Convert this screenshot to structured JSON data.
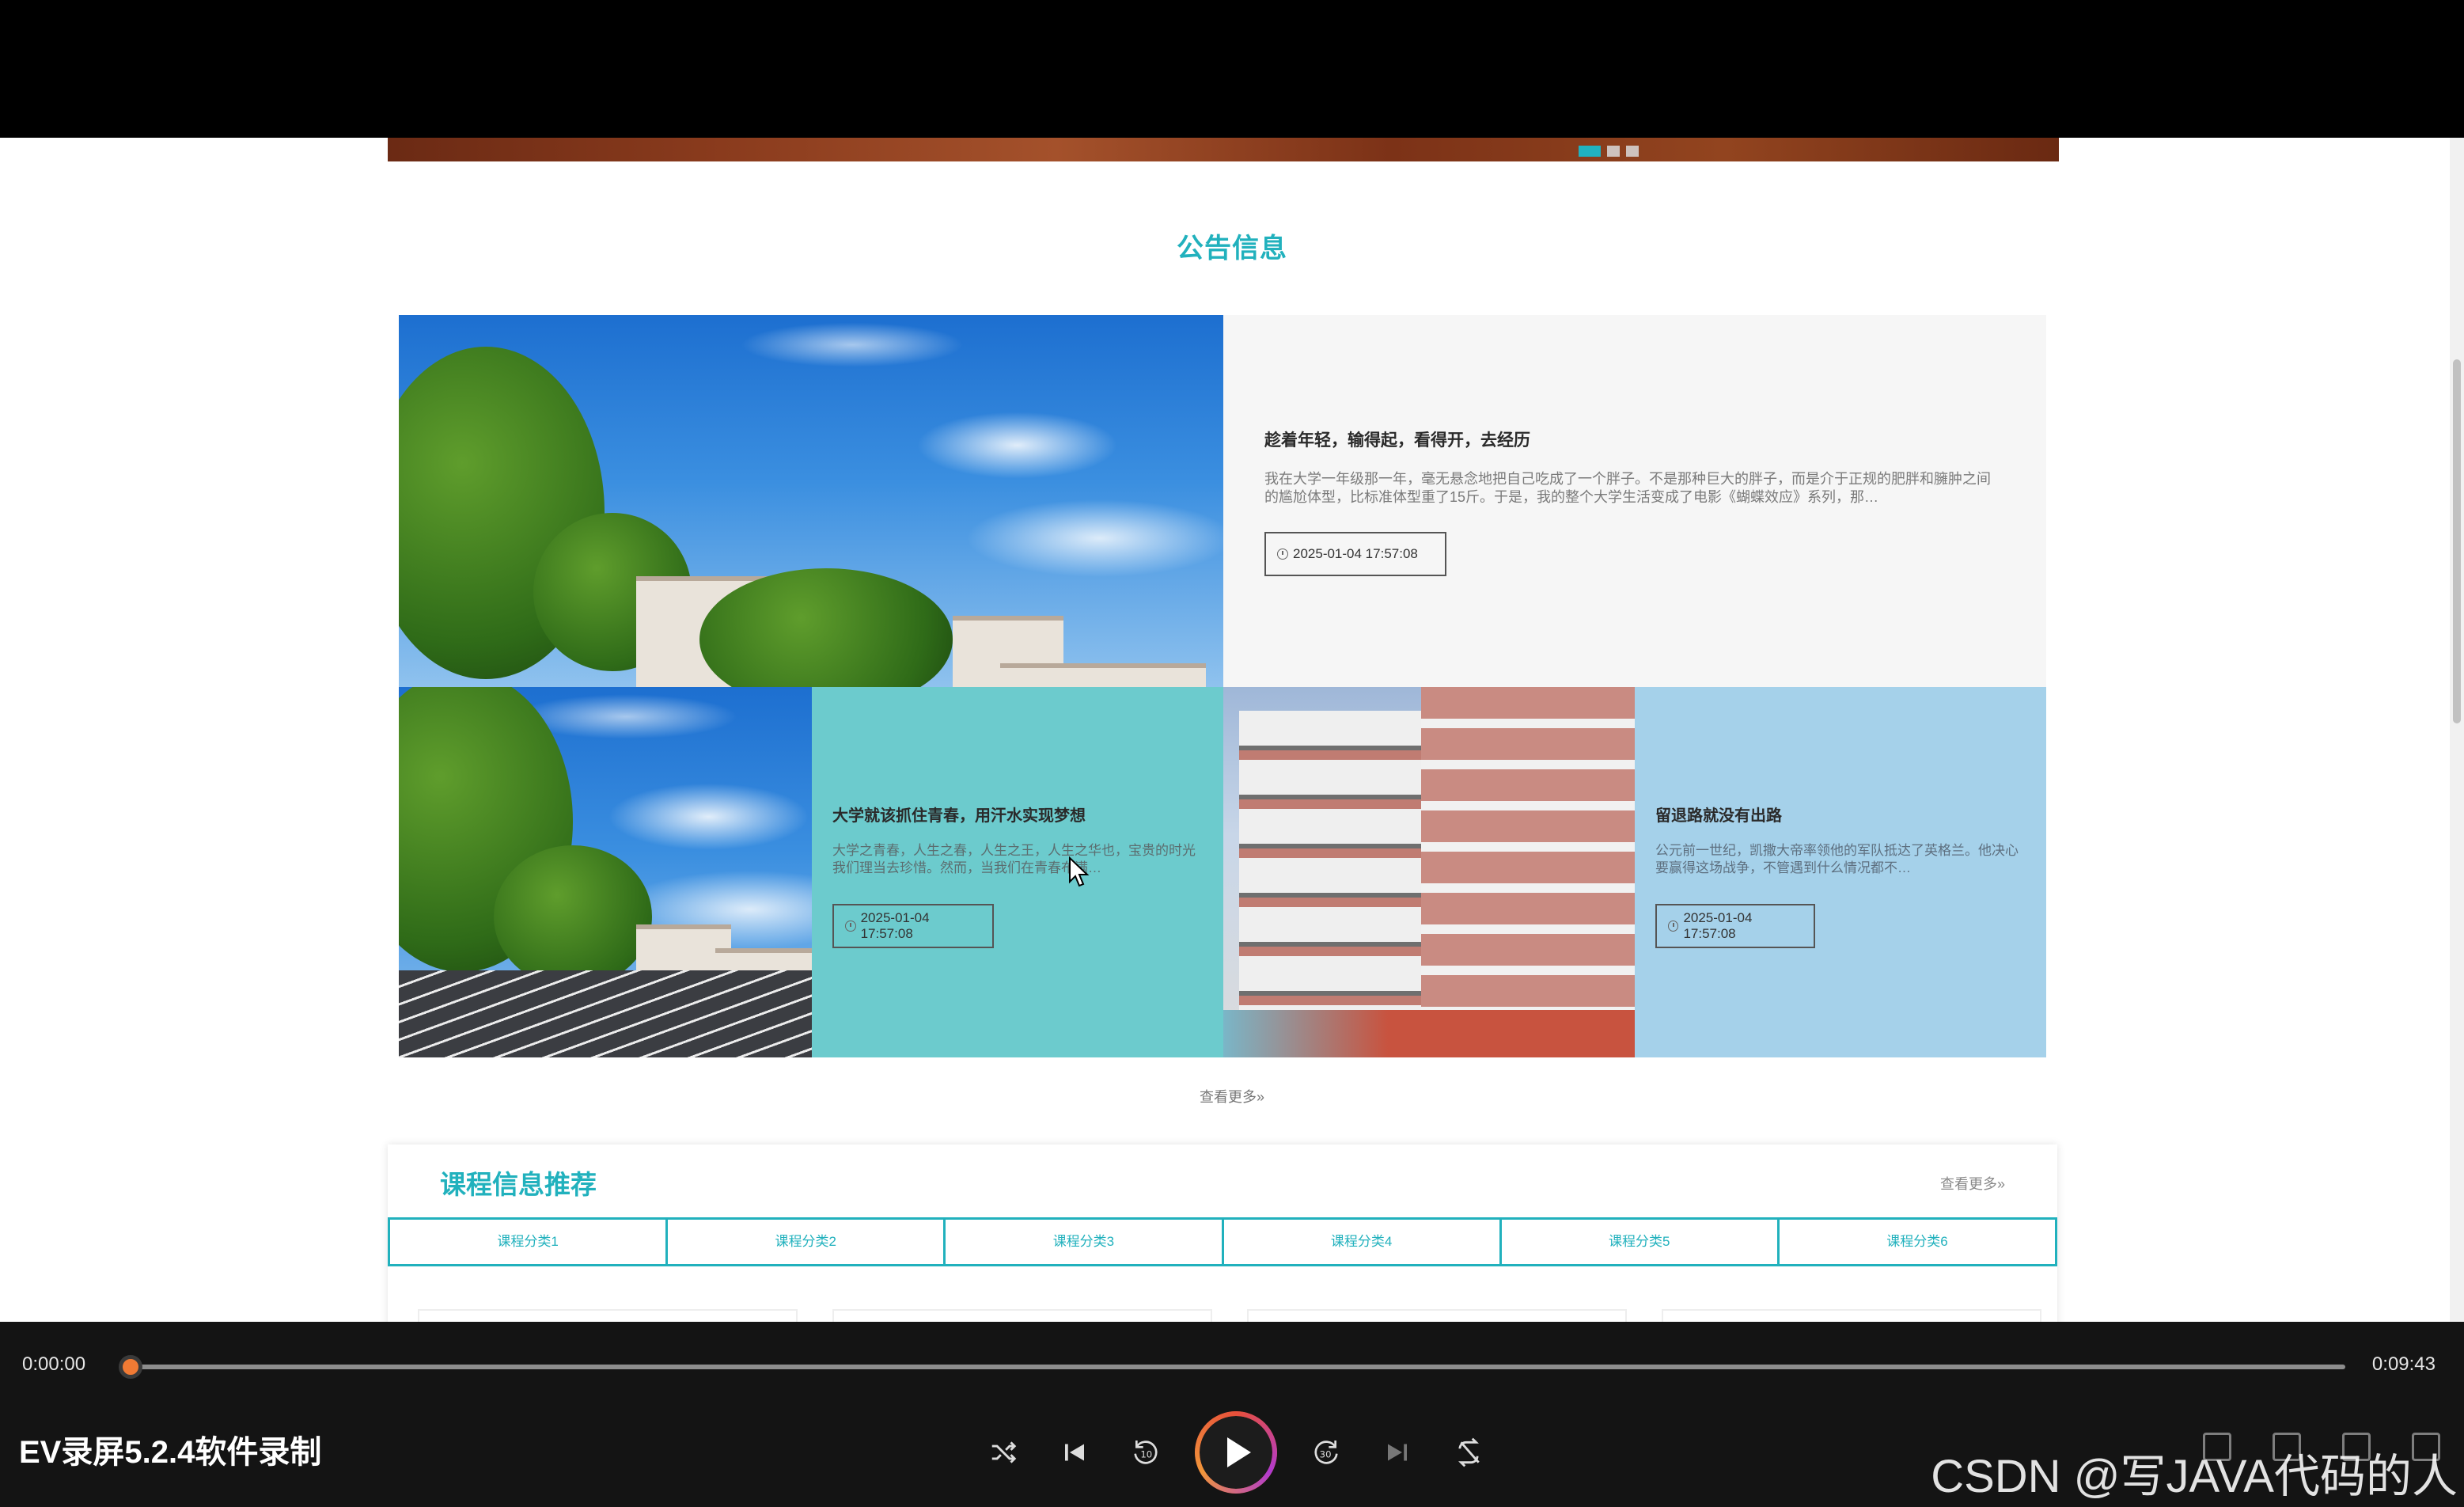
{
  "announcement": {
    "section_title": "公告信息",
    "view_more": "查看更多»",
    "items": [
      {
        "title": "趁着年轻，输得起，看得开，去经历",
        "summary": "我在大学一年级那一年，毫无悬念地把自己吃成了一个胖子。不是那种巨大的胖子，而是介于正规的肥胖和臃肿之间的尴尬体型，比标准体型重了15斤。于是，我的整个大学生活变成了电影《蝴蝶效应》系列，那…",
        "date": "2025-01-04 17:57:08"
      },
      {
        "title": "大学就该抓住青春，用汗水实现梦想",
        "summary": "大学之青春，人生之春，人生之王，人生之华也，宝贵的时光我们理当去珍惜。然而，当我们在青春布满…",
        "date": "2025-01-04 17:57:08"
      },
      {
        "title": "留退路就没有出路",
        "summary": "公元前一世纪，凯撒大帝率领他的军队抵达了英格兰。他决心要赢得这场战争，不管遇到什么情况都不…",
        "date": "2025-01-04 17:57:08"
      }
    ]
  },
  "courses": {
    "title": "课程信息推荐",
    "view_more": "查看更多»",
    "tabs": [
      "课程分类1",
      "课程分类2",
      "课程分类3",
      "课程分类4",
      "课程分类5",
      "课程分类6"
    ]
  },
  "player": {
    "current_time": "0:00:00",
    "total_time": "0:09:43",
    "progress": 0.0,
    "watermark": "EV录屏5.2.4软件录制",
    "icons": [
      "shuffle-icon",
      "previous-icon",
      "rewind-10-icon",
      "play-icon",
      "forward-30-icon",
      "next-icon",
      "repeat-icon"
    ]
  },
  "overlay_text": "CSDN @写JAVA代码的人",
  "colors": {
    "accent": "#21b1bd",
    "teal_panel": "#6ccbcd",
    "blue_panel": "#a5d1ea",
    "gray_panel": "#f6f6f6",
    "play_ring": "#e8503a",
    "seek_knob": "#f07a34"
  }
}
